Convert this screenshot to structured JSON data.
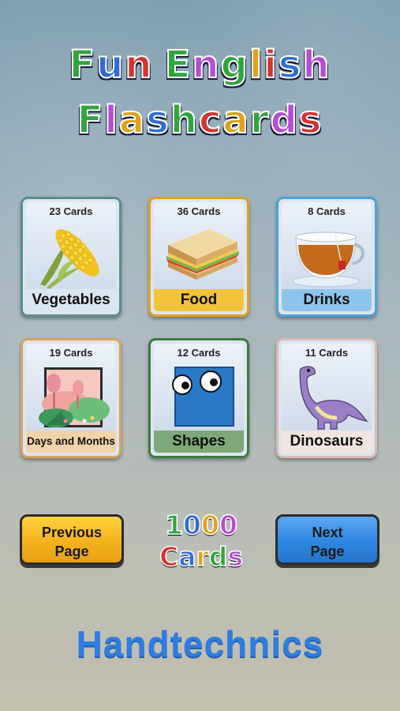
{
  "title": {
    "line1": "Fun English",
    "line2": "Flashcards"
  },
  "colors": {
    "title_letters": [
      "#2fa63a",
      "#2f6fd6",
      "#d6342f",
      "#2fa63a",
      "#b64cd6",
      "#2fa63a",
      "#e0a21c",
      "#d6342f",
      "#2f6fd6",
      "#b64cd6",
      "#2fa63a"
    ],
    "title2_letters": [
      "#2fa63a",
      "#b64cd6",
      "#e0a21c",
      "#2f6fd6",
      "#2fa63a",
      "#d6342f",
      "#e0a21c",
      "#2fa63a",
      "#b64cd6",
      "#d6342f"
    ],
    "brand": "#2e7de0"
  },
  "categories": [
    {
      "name": "Vegetables",
      "count": "23 Cards",
      "icon": "corn-icon",
      "border": "#5b8e8a",
      "label_bg": "#dbe6f3"
    },
    {
      "name": "Food",
      "count": "36 Cards",
      "icon": "sandwich-icon",
      "border": "#e0a21c",
      "label_bg": "#f2c33a"
    },
    {
      "name": "Drinks",
      "count": "8 Cards",
      "icon": "tea-cup-icon",
      "border": "#4aa3dc",
      "label_bg": "#8cc6ef"
    },
    {
      "name": "Days and Months",
      "count": "19 Cards",
      "icon": "landscape-icon",
      "border": "#d9a25e",
      "label_bg": "#f0d3a8"
    },
    {
      "name": "Shapes",
      "count": "12 Cards",
      "icon": "square-face-icon",
      "border": "#3f7a3f",
      "label_bg": "#7fa87a"
    },
    {
      "name": "Dinosaurs",
      "count": "11 Cards",
      "icon": "dinosaur-icon",
      "border": "#d9bcb3",
      "label_bg": "#f2e4df"
    }
  ],
  "nav": {
    "previous": "Previous Page",
    "next": "Next Page"
  },
  "total": {
    "line1": "1000",
    "line2": "Cards"
  },
  "brand": "Handtechnics"
}
